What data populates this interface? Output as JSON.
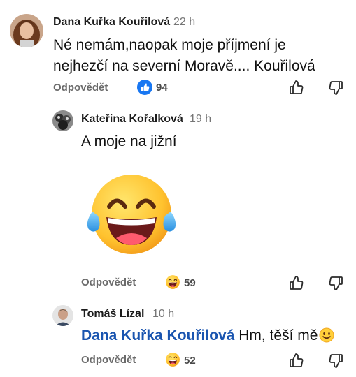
{
  "comments": [
    {
      "author": "Dana Kuřka Kouřilová",
      "time": "22 h",
      "text": "Né nemám,naopak moje příjmení je nejhezčí na severní Moravě.... Kouřilová",
      "reply_label": "Odpovědět",
      "reaction": {
        "icon": "like-reaction-icon",
        "count": "94"
      }
    },
    {
      "author": "Kateřina Kořalková",
      "time": "19 h",
      "text": "A moje na jižní",
      "reply_label": "Odpovědět",
      "reaction": {
        "icon": "laughing-reaction-icon",
        "count": "59"
      }
    },
    {
      "author": "Tomáš Lízal",
      "time": "10 h",
      "mention": "Dana Kuřka Kouřilová",
      "text": " Hm, těší mě",
      "reply_label": "Odpovědět",
      "reaction": {
        "icon": "laughing-reaction-icon",
        "count": "52"
      }
    }
  ],
  "icons": {
    "thumb_up": "thumb-up-icon",
    "thumb_down": "thumb-down-icon",
    "laughing_emoji": "laughing-tears-emoji",
    "smile_emoji": "smiling-face-emoji"
  },
  "colors": {
    "mention": "#1a55b0",
    "like_blue": "#1877f2",
    "emoji_yellow": "#ffcf3a"
  }
}
